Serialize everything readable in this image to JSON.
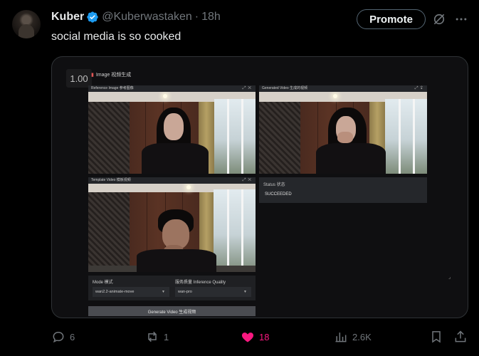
{
  "post": {
    "author_name": "Kuber",
    "author_handle": "@Kuberwastaken",
    "separator": "·",
    "time": "18h",
    "text": "social media is so cooked",
    "promote_label": "Promote"
  },
  "media": {
    "speed": "1.00",
    "app_title": "Image 视频生成",
    "panels": [
      {
        "bar": "Reference Image 参考图像"
      },
      {
        "bar": "Generated Video 生成的视频"
      },
      {
        "bar": "Template Video 模板视频"
      }
    ],
    "status_label": "Status 状态",
    "status_value": "SUCCEEDED",
    "mode_label": "Mode 模式",
    "mode_value": "wan2.2-animate-move",
    "quality_label": "服务质量 Inference Quality",
    "quality_value": "wan-pro",
    "generate_label": "Generate Video 生成视频"
  },
  "actions": {
    "replies": "6",
    "reposts": "1",
    "likes": "18",
    "views": "2.6K"
  },
  "colors": {
    "accent_like": "#f91880",
    "verified_blue": "#1d9bf0",
    "muted": "#71767b"
  },
  "icons": [
    "verified-badge-icon",
    "grok-icon",
    "more-icon",
    "reply-icon",
    "repost-icon",
    "like-icon",
    "views-icon",
    "bookmark-icon",
    "share-icon"
  ]
}
